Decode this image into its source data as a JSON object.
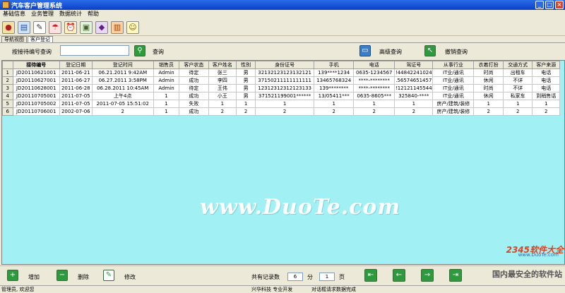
{
  "window": {
    "title": "汽车客户管理系统"
  },
  "menu": [
    "基础信息",
    "业务管理",
    "数据统计",
    "帮助"
  ],
  "toolbar_icons": [
    "users-icon",
    "notebook-icon",
    "edit-icon",
    "umbrella-icon",
    "alarm-clock-icon",
    "picture-icon",
    "book-icon",
    "gift-icon",
    "runner-icon"
  ],
  "tabs": [
    "导航视图",
    "客户登记"
  ],
  "search": {
    "label": "按接待编号查询",
    "value": "",
    "button_label": "查询",
    "advanced_label": "高级查询",
    "undo_label": "撤销查询"
  },
  "table": {
    "columns": [
      "",
      "接待编号",
      "登记日期",
      "登记时间",
      "销售员",
      "客户状态",
      "客户姓名",
      "性别",
      "身份证号",
      "手机",
      "电话",
      "驾证号",
      "从事行业",
      "衣着打扮",
      "交通方式",
      "客户来源"
    ],
    "rows": [
      [
        "1",
        "JD20110621001",
        "2011-06-21",
        "06.21.2011  9:42AM",
        "Admin",
        "待定",
        "张三",
        "男",
        "32132123123132121",
        "139****1234",
        "0635-1234567",
        "!44842241024",
        "IT业/通讯",
        "时尚",
        "出租车",
        "电话"
      ],
      [
        "2",
        "JD20110627001",
        "2011-06-27",
        "06.27.2011  3:58PM",
        "Admin",
        "成功",
        "李四",
        "男",
        "37150211111111111",
        "13465768324",
        "****-********",
        ".56574651457",
        "IT业/通讯",
        "休闲",
        "不详",
        "电话"
      ],
      [
        "3",
        "JD20110628001",
        "2011-06-28",
        "06.28.2011 10:45AM",
        "Admin",
        "待定",
        "王伟",
        "男",
        "12312312312123133",
        "139********",
        "****-********",
        "!12121145544",
        "IT业/通讯",
        "时尚",
        "不详",
        "电话"
      ],
      [
        "4",
        "JD20110705001",
        "2011-07-05",
        "上午4点",
        "1",
        "成功",
        "小王",
        "男",
        "371521199001******",
        "13/05411***",
        "0635-8605***",
        "325840-****",
        "IT业/通讯",
        "休闲",
        "私家车",
        "到稍售话"
      ],
      [
        "5",
        "JD20110705002",
        "2011-07-05",
        "2011-07-05 15:51:02",
        "1",
        "失败",
        "1",
        "1",
        "1",
        "1",
        "1",
        "1",
        "房产/建筑/装修",
        "1",
        "1",
        "1"
      ],
      [
        "6",
        "JD20110706001",
        "2002-07-06",
        "2",
        "1",
        "成功",
        "2",
        "2",
        "2",
        "2",
        "2",
        "2",
        "房产/建筑/装修",
        "2",
        "2",
        "2"
      ]
    ]
  },
  "watermark": "www.DuoTe.com",
  "watermark_small": "www.DuoTe.com",
  "actions": {
    "add": "增加",
    "delete": "删除",
    "edit": "修改"
  },
  "pager": {
    "total_label": "共有记录数",
    "total": "6",
    "pages_label": "分",
    "current": "1",
    "page_label": "页"
  },
  "status": {
    "user": "管理员, 欢迎您",
    "company": "兴华科技 专业开发",
    "message": "对话框请求数据完成"
  },
  "logo_text": "2345软件大全",
  "logo_sub": "国内最安全的软件站"
}
